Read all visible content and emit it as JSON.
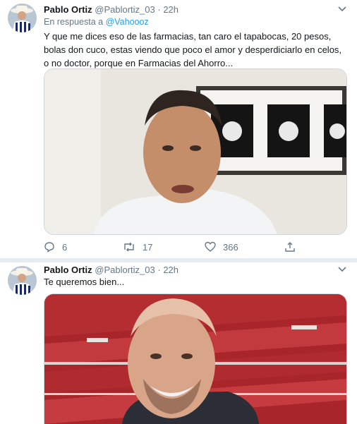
{
  "tweets": [
    {
      "author_name": "Pablo Ortiz",
      "handle": "@Pablortiz_03",
      "dot": "·",
      "time": "22h",
      "reply_label": "En respuesta a",
      "reply_user": "@Vahoooz",
      "text": "Y que me dices eso de las farmacias, tan caro el tapabocas, 20 pesos, bolas don cuco, estas viendo que poco el amor y desperdiciarlo en celos, o no doctor, porque en Farmacias del Ahorro...",
      "replies": "6",
      "retweets": "17",
      "likes": "366"
    },
    {
      "author_name": "Pablo Ortiz",
      "handle": "@Pablortiz_03",
      "dot": "·",
      "time": "22h",
      "text": "Te queremos bien..."
    }
  ],
  "icons": {
    "avatar": "avatar-icon",
    "caret": "chevron-down-icon",
    "reply": "reply-icon",
    "retweet": "retweet-icon",
    "like": "heart-icon",
    "share": "share-icon"
  },
  "colors": {
    "link": "#1da1f2",
    "secondary": "#657786",
    "separator": "#e6ecf0"
  }
}
